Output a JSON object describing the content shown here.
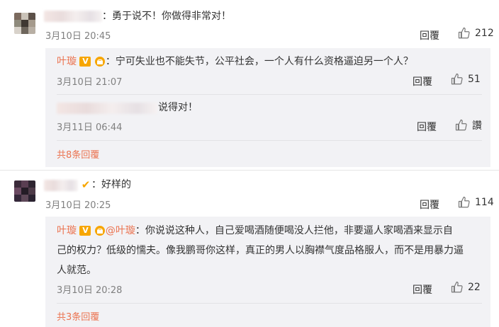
{
  "comments": [
    {
      "text": "：勇于说不！你做得非常对！",
      "time": "3月10日 20:45",
      "reply": "回覆",
      "likes": "212",
      "sub_replies": [
        {
          "name": "叶璇",
          "text": "：宁可失业也不能失节，公平社会，一个人有什么资格逼迫另一个人？",
          "time": "3月10日 21:07",
          "reply": "回覆",
          "likes": "51"
        },
        {
          "text": "说得对！",
          "time": "3月11日 06:44",
          "reply": "回覆",
          "likes": "讚"
        }
      ],
      "more": "共8条回覆"
    },
    {
      "text": "：好样的",
      "time": "3月10日 20:25",
      "reply": "回覆",
      "likes": "114",
      "sub_replies": [
        {
          "name": "叶璇",
          "mention": "@叶璇",
          "text_line1": "：你说说这种人，自己爱喝酒随便喝没人拦他，非要逼人家喝酒来显示自",
          "text_line2": "己的权力？低级的懦夫。像我鹏哥你这样，真正的男人以胸襟气度品格服人，而不是用暴力逼",
          "text_line3": "人就范。",
          "time": "3月10日 20:28",
          "reply": "回覆",
          "likes": "22"
        }
      ],
      "more": "共3条回覆"
    }
  ],
  "colors": {
    "accent": "#eb7350",
    "sub_bg": "#f2f2f5",
    "verified": "#f7a600"
  },
  "icons": {
    "like": "thumbs-up-icon",
    "verified": "verified-v-icon"
  }
}
